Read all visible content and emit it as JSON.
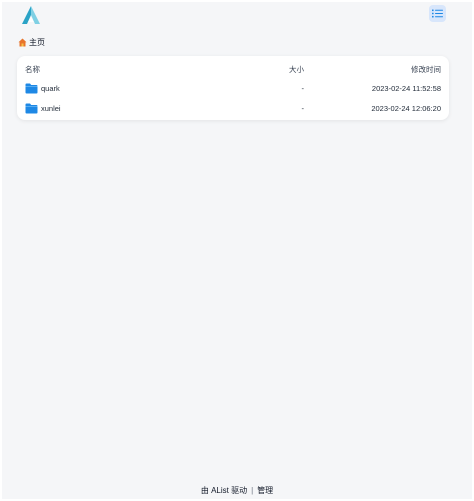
{
  "breadcrumb": {
    "home_label": "主页"
  },
  "table": {
    "headers": {
      "name": "名称",
      "size": "大小",
      "modified": "修改时间"
    },
    "rows": [
      {
        "name": "quark",
        "size": "-",
        "modified": "2023-02-24 11:52:58"
      },
      {
        "name": "xunlei",
        "size": "-",
        "modified": "2023-02-24 12:06:20"
      }
    ]
  },
  "footer": {
    "powered_by": "由 AList 驱动",
    "separator": "|",
    "manage": "管理"
  },
  "icons": {
    "logo": "alist-logo-icon",
    "list_view": "list-view-icon",
    "home": "home-icon",
    "folder": "folder-icon"
  },
  "colors": {
    "accent": "#1e88e5",
    "folder": "#1e88e5",
    "logo_primary": "#2ba3c6",
    "logo_secondary": "#7fd0e4",
    "background": "#f5f6f8"
  }
}
